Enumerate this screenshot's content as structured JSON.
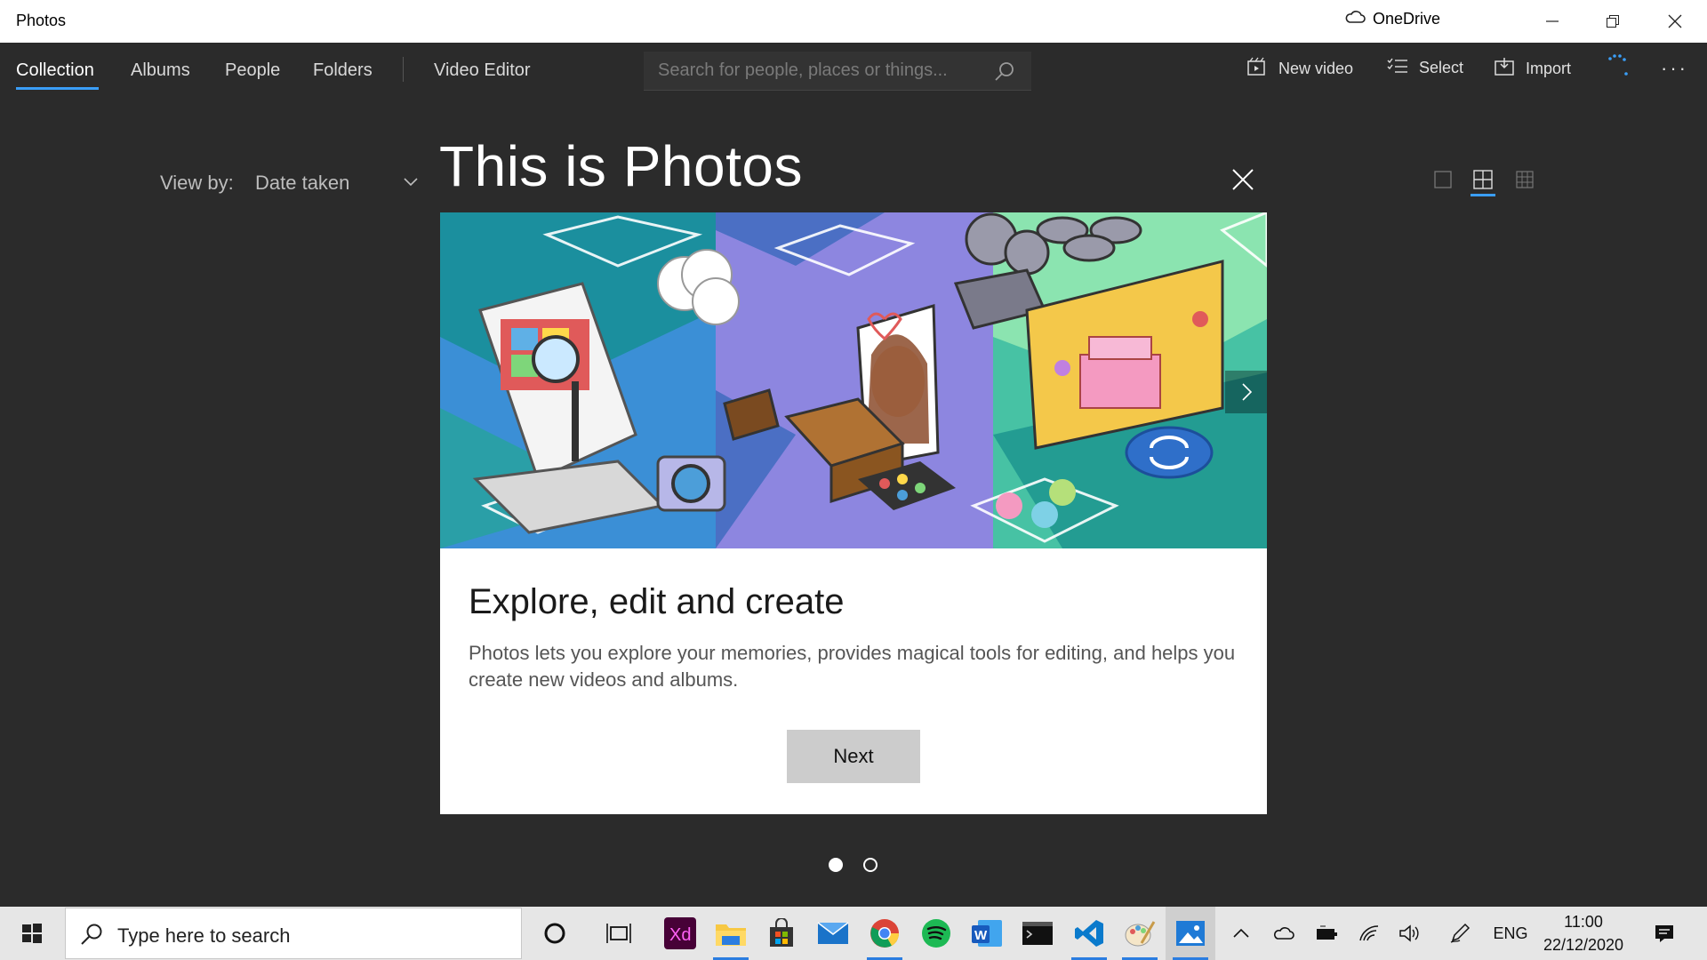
{
  "window": {
    "title": "Photos",
    "onedrive_label": "OneDrive"
  },
  "nav": {
    "tabs": [
      {
        "label": "Collection",
        "active": true
      },
      {
        "label": "Albums"
      },
      {
        "label": "People"
      },
      {
        "label": "Folders"
      },
      {
        "label": "Video Editor"
      }
    ]
  },
  "search": {
    "placeholder": "Search for people, places or things..."
  },
  "commands": {
    "new_video": "New video",
    "select": "Select",
    "import": "Import"
  },
  "viewby": {
    "label": "View by:",
    "value": "Date taken"
  },
  "dialog": {
    "title": "This is Photos",
    "heading": "Explore, edit and create",
    "body": "Photos lets you explore your memories, provides magical tools for editing, and helps you create new videos and albums.",
    "next_label": "Next",
    "page_count": 2,
    "current_page": 1
  },
  "taskbar": {
    "search_placeholder": "Type here to search",
    "apps": [
      "cortana-icon",
      "task-view-icon",
      "adobe-xd-icon",
      "file-explorer-icon",
      "store-icon",
      "mail-icon",
      "chrome-icon",
      "spotify-icon",
      "word-icon",
      "terminal-icon",
      "vscode-icon",
      "paint-icon",
      "photos-icon"
    ],
    "language": "ENG",
    "time": "11:00",
    "date": "22/12/2020"
  },
  "colors": {
    "accent": "#3a9ef7",
    "background": "#2b2b2b"
  }
}
